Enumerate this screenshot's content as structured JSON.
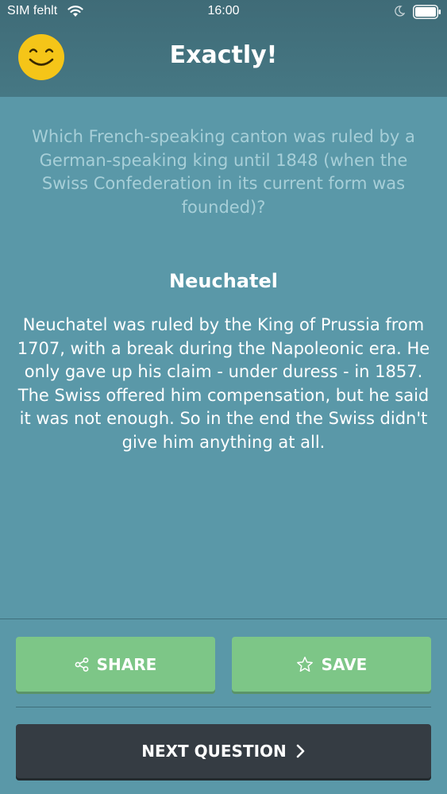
{
  "status_bar": {
    "carrier": "SIM fehlt",
    "time": "16:00"
  },
  "header": {
    "title": "Exactly!"
  },
  "question": {
    "text": "Which French-speaking canton was ruled by a German-speaking king until 1848 (when the Swiss Confederation in its current form was founded)?"
  },
  "answer": {
    "title": "Neuchatel",
    "explanation": "Neuchatel was ruled by the King of Prussia from 1707, with a break during the Napoleonic era. He only gave up his claim - under duress - in 1857. The Swiss offered him compensation, but he said it was not enough. So in the end the Swiss didn't give him anything at all."
  },
  "actions": {
    "share_label": "SHARE",
    "save_label": "SAVE",
    "next_label": "NEXT QUESTION"
  },
  "icons": {
    "status": [
      "wifi-icon",
      "moon-icon",
      "battery-icon"
    ],
    "header": "smiley-icon",
    "share": "share-icon",
    "save": "star-icon",
    "next": "chevron-right-icon"
  },
  "colors": {
    "background": "#5a98a8",
    "header": "#467884",
    "question_text": "#a7cfd8",
    "action_green": "#7dc687",
    "next_button": "#353c43",
    "smiley": "#f5c518"
  }
}
